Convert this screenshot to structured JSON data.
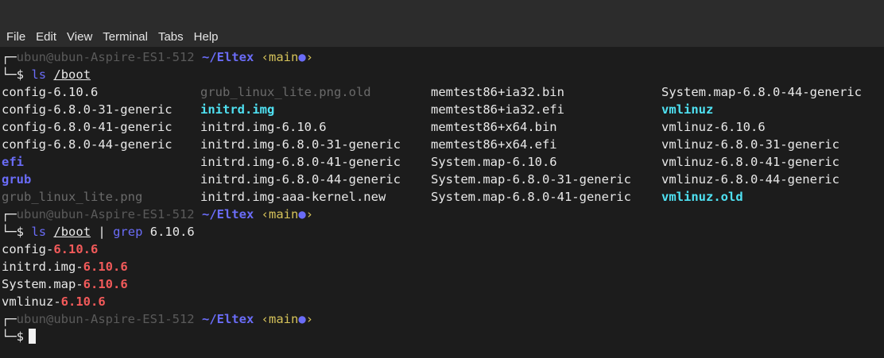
{
  "menu": {
    "file": "File",
    "edit": "Edit",
    "view": "View",
    "terminal": "Terminal",
    "tabs": "Tabs",
    "help": "Help"
  },
  "prompt": {
    "user_host": "ubun@ubun-Aspire-ES1-512",
    "path": "~/Eltex",
    "branch": "‹main",
    "dot": "●",
    "branch_close": "›",
    "dollar": "$"
  },
  "cmd1": {
    "name": "ls",
    "arg": "/boot"
  },
  "ls_output": [
    [
      "config-6.10.6",
      "grub_linux_lite.png.old",
      "memtest86+ia32.bin",
      "System.map-6.8.0-44-generic"
    ],
    [
      "config-6.8.0-31-generic",
      "initrd.img",
      "memtest86+ia32.efi",
      "vmlinuz"
    ],
    [
      "config-6.8.0-41-generic",
      "initrd.img-6.10.6",
      "memtest86+x64.bin",
      "vmlinuz-6.10.6"
    ],
    [
      "config-6.8.0-44-generic",
      "initrd.img-6.8.0-31-generic",
      "memtest86+x64.efi",
      "vmlinuz-6.8.0-31-generic"
    ],
    [
      "efi",
      "initrd.img-6.8.0-41-generic",
      "System.map-6.10.6",
      "vmlinuz-6.8.0-41-generic"
    ],
    [
      "grub",
      "initrd.img-6.8.0-44-generic",
      "System.map-6.8.0-31-generic",
      "vmlinuz-6.8.0-44-generic"
    ],
    [
      "grub_linux_lite.png",
      "initrd.img-aaa-kernel.new",
      "System.map-6.8.0-41-generic",
      "vmlinuz.old"
    ]
  ],
  "ls_styles": [
    [
      "",
      "dim",
      "",
      ""
    ],
    [
      "",
      "cyan",
      "",
      "cyan"
    ],
    [
      "",
      "",
      "",
      ""
    ],
    [
      "",
      "",
      "",
      ""
    ],
    [
      "blue",
      "",
      "",
      ""
    ],
    [
      "blue",
      "",
      "",
      ""
    ],
    [
      "dim",
      "",
      "",
      "cyan"
    ]
  ],
  "cmd2": {
    "name": "ls",
    "arg": "/boot",
    "pipe": "|",
    "grep": "grep",
    "pattern": "6.10.6"
  },
  "grep_output": [
    {
      "prefix": "config-",
      "match": "6.10.6"
    },
    {
      "prefix": "initrd.img-",
      "match": "6.10.6"
    },
    {
      "prefix": "System.map-",
      "match": "6.10.6"
    },
    {
      "prefix": "vmlinuz-",
      "match": "6.10.6"
    }
  ],
  "colors": {
    "background": "#1c1c1c",
    "menubar": "#2c2c2c",
    "path": "#6a6cf7",
    "branch": "#d6c35a",
    "match": "#f25a5a",
    "link": "#4fe1f2"
  }
}
